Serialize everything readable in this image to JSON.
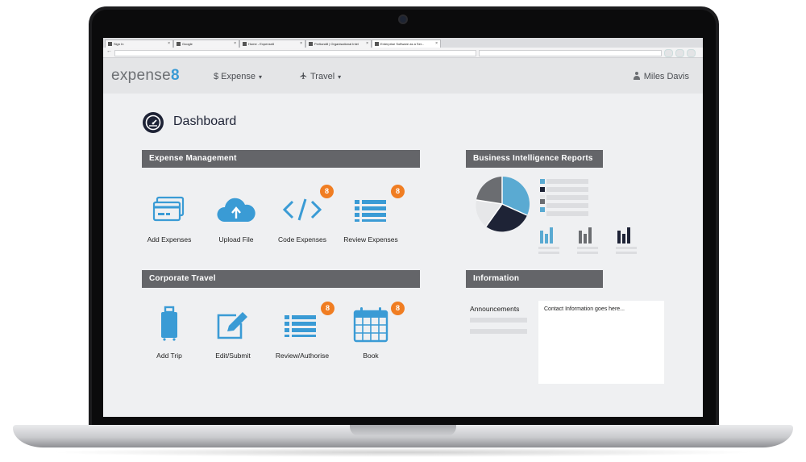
{
  "browser": {
    "tabs": [
      {
        "label": "Sign In"
      },
      {
        "label": "Google"
      },
      {
        "label": "Home - Expense8"
      },
      {
        "label": "Pertland8 | Organisational Intel"
      },
      {
        "label": "Enterprise Software as a Ser..."
      }
    ],
    "tab_close": "×",
    "back_glyph": "←"
  },
  "app": {
    "logo_text": "expense",
    "logo_mark": "8",
    "nav": {
      "expense_label": "$ Expense",
      "travel_label": "Travel",
      "caret": "▾",
      "user_name": "Miles Davis"
    }
  },
  "page": {
    "title": "Dashboard",
    "expense_section": {
      "header": "Expense Management",
      "tiles": [
        {
          "label": "Add Expenses",
          "icon": "credit-card-icon"
        },
        {
          "label": "Upload File",
          "icon": "cloud-upload-icon"
        },
        {
          "label": "Code Expenses",
          "icon": "code-icon",
          "badge": "8"
        },
        {
          "label": "Review Expenses",
          "icon": "list-icon",
          "badge": "8"
        }
      ]
    },
    "travel_section": {
      "header": "Corporate Travel",
      "tiles": [
        {
          "label": "Add Trip",
          "icon": "luggage-icon"
        },
        {
          "label": "Edit/Submit",
          "icon": "edit-icon"
        },
        {
          "label": "Review/Authorise",
          "icon": "list-icon",
          "badge": "8"
        },
        {
          "label": "Book",
          "icon": "calendar-icon",
          "badge": "8"
        }
      ]
    },
    "bi_section": {
      "header": "Business Intelligence Reports"
    },
    "info_section": {
      "header": "Information",
      "announcements_label": "Announcements",
      "contact_text": "Contact Information goes here..."
    }
  },
  "colors": {
    "accent_blue": "#3a9bd5",
    "navy": "#1e2336",
    "badge_orange": "#f07d22",
    "section_grey": "#646569"
  }
}
